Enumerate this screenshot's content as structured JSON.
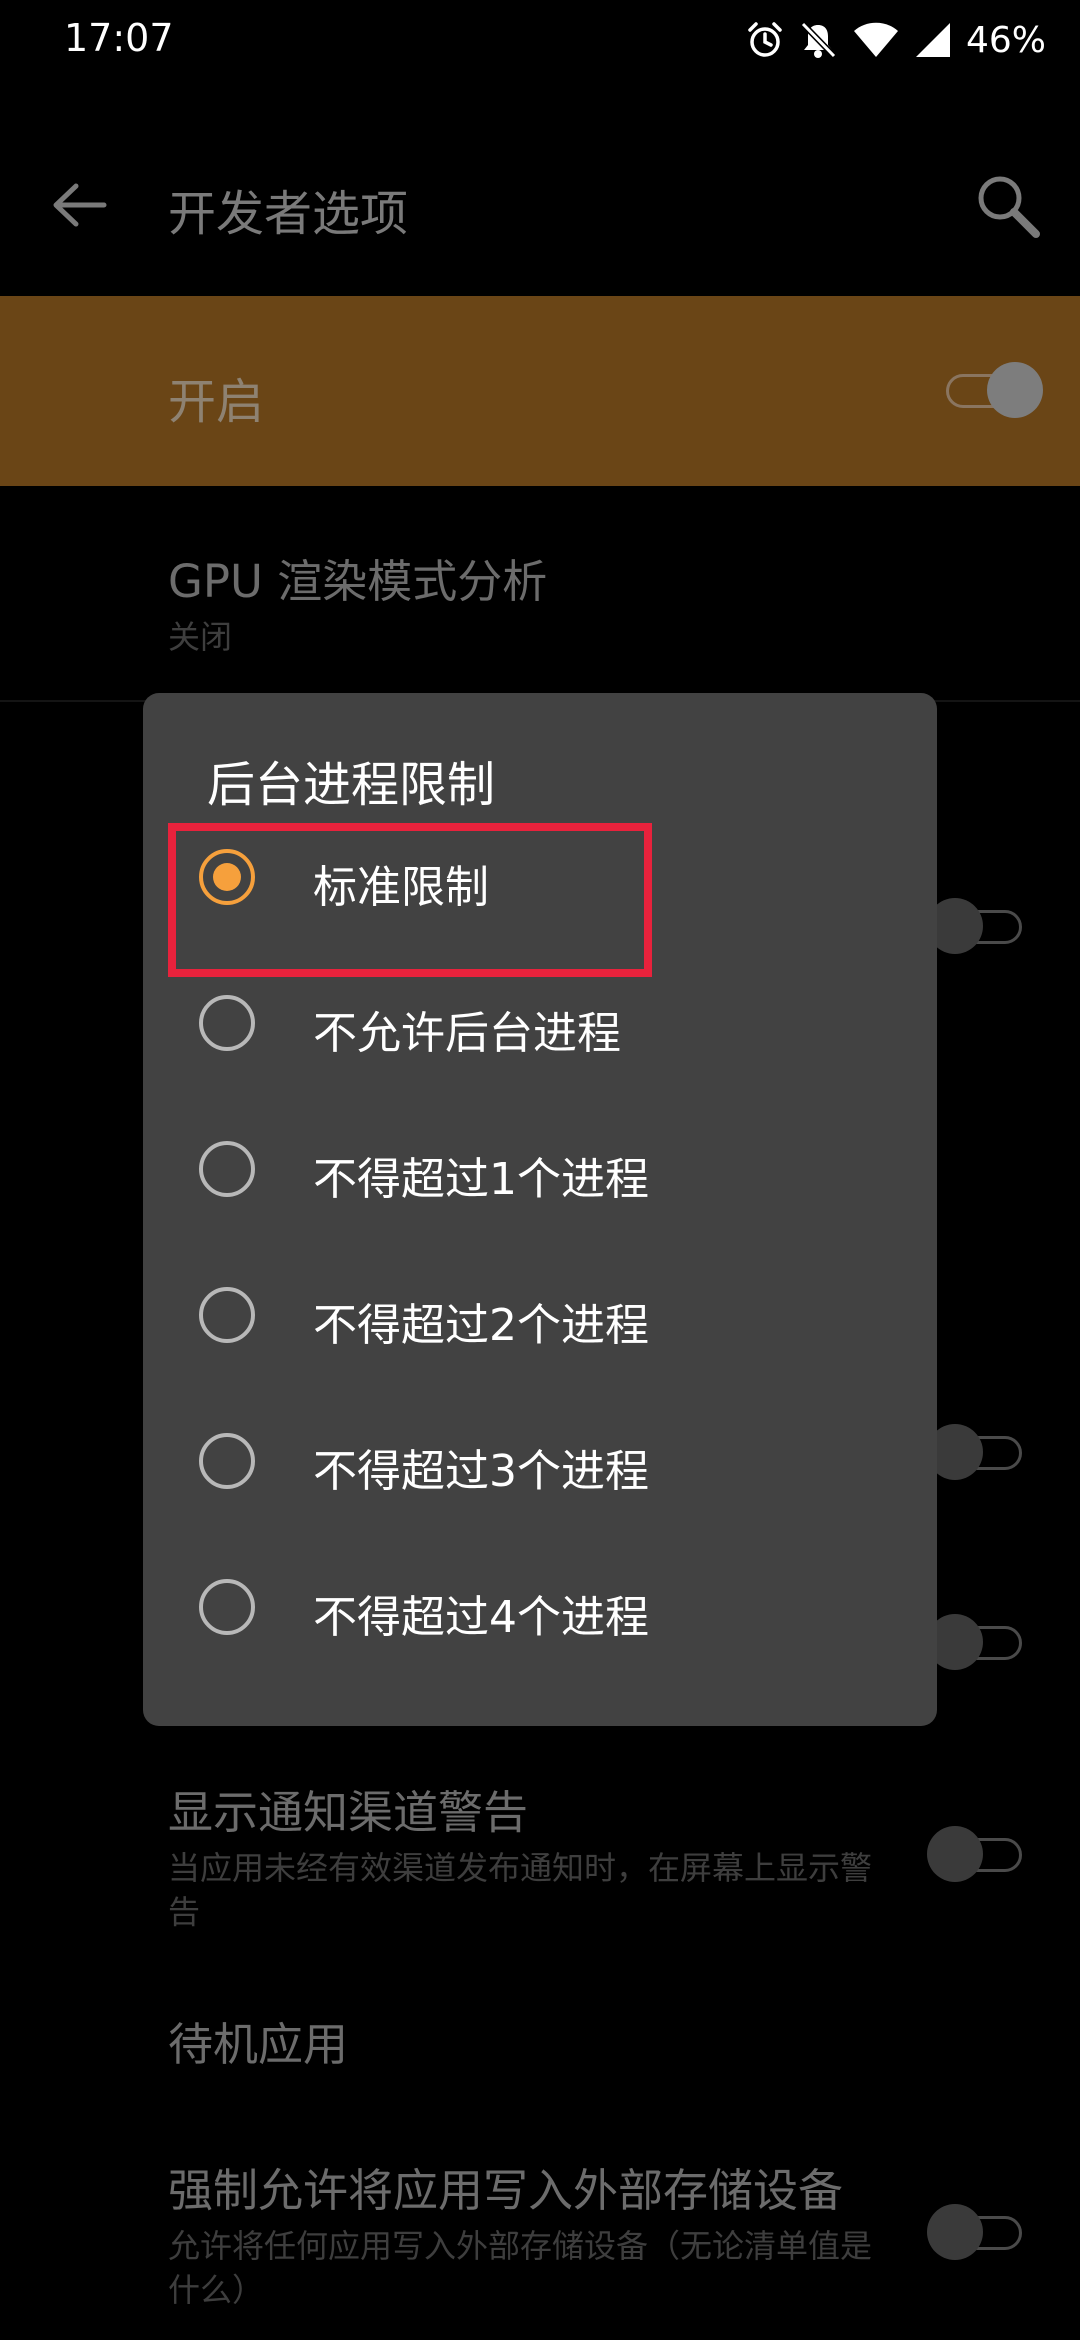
{
  "status_bar": {
    "time": "17:07",
    "battery": "46%",
    "icons": [
      "alarm-icon",
      "notifications-off-icon",
      "wifi-icon",
      "cellular-signal-icon"
    ]
  },
  "app_bar": {
    "title": "开发者选项",
    "back_icon": "arrow-back-icon",
    "search_icon": "search-icon"
  },
  "master_switch": {
    "label": "开启",
    "state": "on"
  },
  "settings": [
    {
      "title": "GPU 渲染模式分析",
      "summary": "关闭"
    },
    {
      "title": "显示通知渠道警告",
      "summary": "当应用未经有效渠道发布通知时，在屏幕上显示警告",
      "toggle": "off"
    },
    {
      "title": "待机应用"
    },
    {
      "title": "强制允许将应用写入外部存储设备",
      "summary": "允许将任何应用写入外部存储设备（无论清单值是什么）",
      "toggle": "off"
    }
  ],
  "dialog": {
    "title": "后台进程限制",
    "options": [
      {
        "label": "标准限制",
        "selected": true
      },
      {
        "label": "不允许后台进程",
        "selected": false
      },
      {
        "label": "不得超过1个进程",
        "selected": false
      },
      {
        "label": "不得超过2个进程",
        "selected": false
      },
      {
        "label": "不得超过3个进程",
        "selected": false
      },
      {
        "label": "不得超过4个进程",
        "selected": false
      }
    ]
  },
  "colors": {
    "accent": "#f6a03c",
    "master_row_bg": "#6a4516",
    "dialog_bg": "#424242",
    "highlight": "#e8223c"
  }
}
